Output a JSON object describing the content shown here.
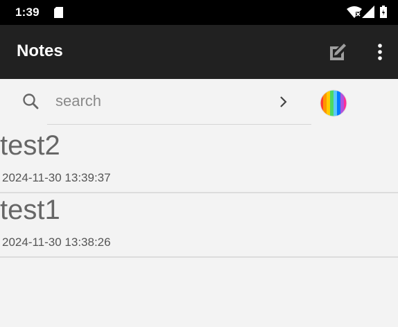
{
  "status_bar": {
    "time": "1:39",
    "icons": [
      "sd-card-icon",
      "wifi-icon",
      "signal-icon",
      "battery-icon"
    ]
  },
  "app_bar": {
    "title": "Notes",
    "background_color": "#212121",
    "actions": [
      "compose-icon",
      "more-vert-icon"
    ]
  },
  "search": {
    "placeholder": "search",
    "value": ""
  },
  "notes": [
    {
      "title": "test2",
      "date": "2024-11-30  13:39:37"
    },
    {
      "title": "test1",
      "date": "2024-11-30  13:38:26"
    }
  ],
  "colors": {
    "background": "#f3f3f3",
    "divider": "#dcdcdc",
    "palette": [
      "#ff3b30",
      "#ff9500",
      "#ffcc00",
      "#4cd964",
      "#5ac8fa",
      "#007aff",
      "#af52de",
      "#ff2d95"
    ]
  }
}
